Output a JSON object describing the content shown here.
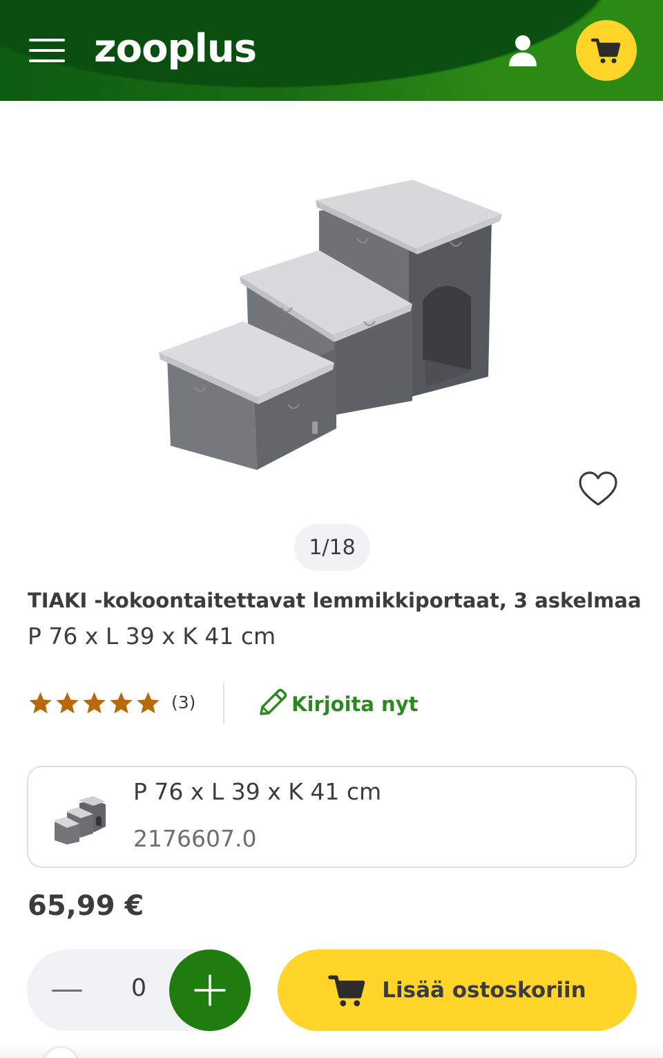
{
  "header": {
    "logo_text": "zooplus",
    "menu_icon": "hamburger-menu-icon",
    "account_icon": "user-icon",
    "cart_icon": "shopping-cart-icon",
    "accent_color": "#ffd52a",
    "brand_green": "#1f7d10"
  },
  "gallery": {
    "counter": "1/18",
    "wishlist_icon": "heart-outline-icon"
  },
  "product": {
    "title": "TIAKI -kokoontaitettavat lemmikkiportaat, 3 askelmaa",
    "subtitle": "P 76 x L 39 x K 41 cm"
  },
  "rating": {
    "stars": 5,
    "count_label": "(3)",
    "star_color": "#b86a0a",
    "write_review_label": "Kirjoita nyt",
    "write_review_icon": "pencil-icon"
  },
  "variant": {
    "size": "P 76 x L 39 x K 41 cm",
    "sku": "2176607.0"
  },
  "price": "65,99 €",
  "quantity": {
    "value": "0",
    "minus_icon": "minus-icon",
    "plus_icon": "plus-icon"
  },
  "cta": {
    "label": "Lisää ostoskoriin",
    "icon": "shopping-cart-icon"
  }
}
